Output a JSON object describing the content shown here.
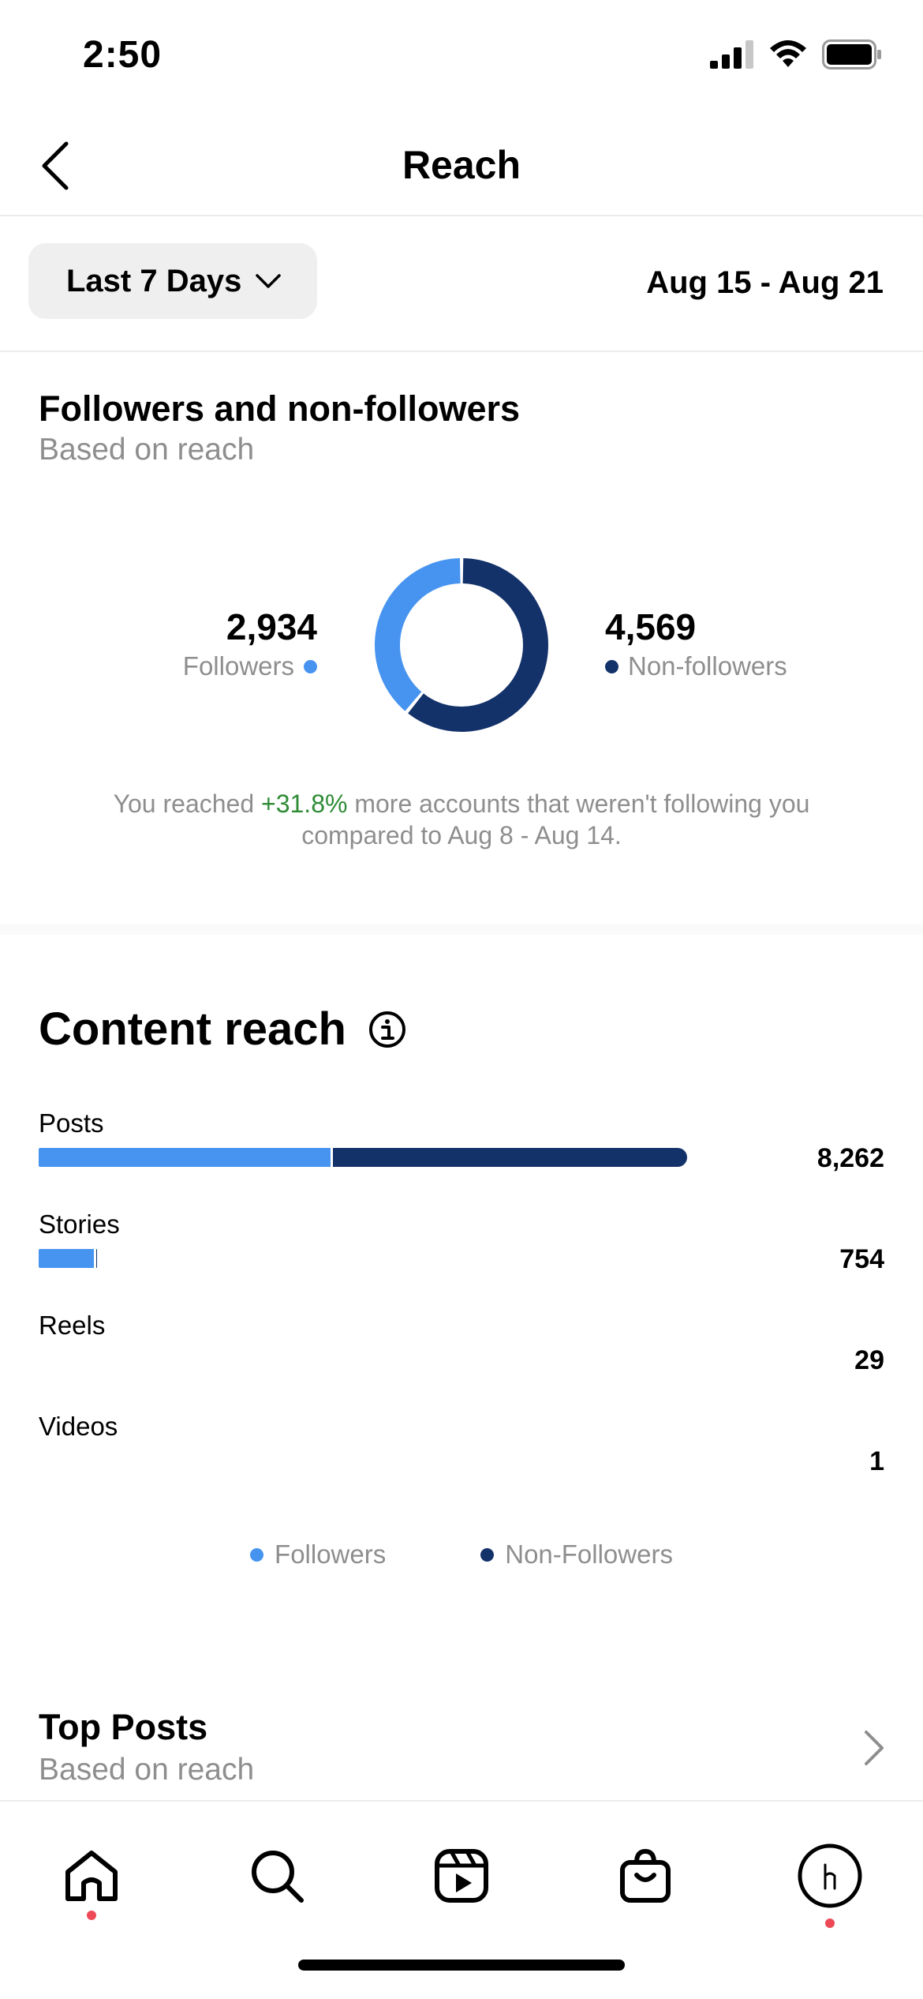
{
  "status_bar": {
    "time": "2:50"
  },
  "nav": {
    "title": "Reach"
  },
  "filter": {
    "range_label": "Last 7 Days",
    "date_range": "Aug 15 - Aug 21"
  },
  "audience": {
    "title": "Followers and non-followers",
    "subtitle": "Based on reach",
    "followers_value": "2,934",
    "followers_label": "Followers",
    "nonfollowers_value": "4,569",
    "nonfollowers_label": "Non-followers",
    "donut_followers_fraction": 0.391,
    "compare_prefix": "You reached ",
    "compare_change": "+31.8%",
    "compare_suffix": " more accounts that weren't following you compared to Aug 8 - Aug 14."
  },
  "content_reach": {
    "title": "Content reach",
    "rows": [
      {
        "label": "Posts",
        "value": "8,262",
        "followers_fraction": 0.45,
        "total_fraction": 1.0
      },
      {
        "label": "Stories",
        "value": "754",
        "followers_fraction": 0.95,
        "total_fraction": 0.09
      },
      {
        "label": "Reels",
        "value": "29",
        "followers_fraction": 0,
        "total_fraction": 0
      },
      {
        "label": "Videos",
        "value": "1",
        "followers_fraction": 0,
        "total_fraction": 0
      }
    ],
    "legend_followers": "Followers",
    "legend_nonfollowers": "Non-Followers"
  },
  "top_posts": {
    "title": "Top Posts",
    "subtitle": "Based on reach"
  },
  "colors": {
    "followers": "#4694f0",
    "nonfollowers": "#14326a",
    "positive": "#2e8b35",
    "notification": "#ed4956"
  },
  "tabs": [
    "home-icon",
    "search-icon",
    "reels-icon",
    "shop-icon",
    "profile-avatar"
  ]
}
